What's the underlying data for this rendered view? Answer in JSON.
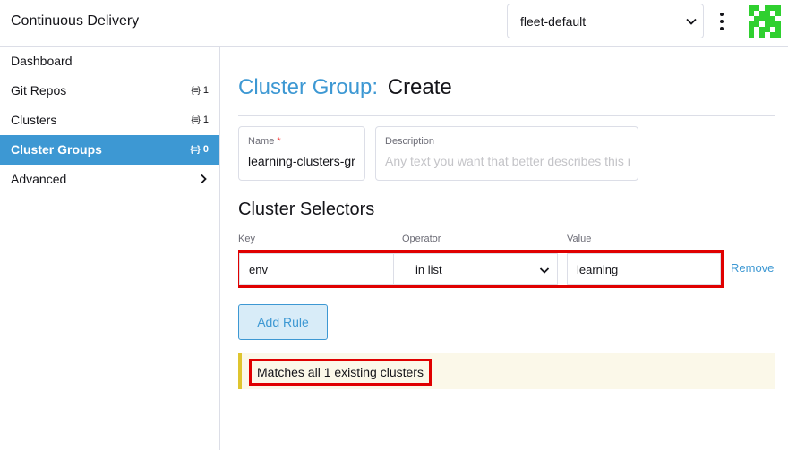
{
  "header": {
    "app_title": "Continuous Delivery",
    "workspace_select": {
      "selected": "fleet-default"
    },
    "more_menu_icon": "kebab-vertical-icon",
    "logo_icon": "rancher-checker-logo"
  },
  "sidebar": {
    "items": [
      {
        "label": "Dashboard",
        "count": "",
        "active": false
      },
      {
        "label": "Git Repos",
        "count": "1",
        "active": false
      },
      {
        "label": "Clusters",
        "count": "1",
        "active": false
      },
      {
        "label": "Cluster Groups",
        "count": "0",
        "active": true
      },
      {
        "label": "Advanced",
        "count": "",
        "active": false,
        "expandable": true
      }
    ],
    "count_icon": "braces-icon"
  },
  "main": {
    "title_resource": "Cluster Group:",
    "title_mode": "Create",
    "name_field": {
      "label": "Name",
      "required_mark": "*",
      "value": "learning-clusters-gr"
    },
    "description_field": {
      "label": "Description",
      "placeholder": "Any text you want that better describes this r"
    },
    "selectors": {
      "section_title": "Cluster Selectors",
      "columns": {
        "key": "Key",
        "operator": "Operator",
        "value": "Value"
      },
      "rules": [
        {
          "key": "env",
          "operator": "in list",
          "value": "learning",
          "remove_label": "Remove"
        }
      ],
      "add_rule_label": "Add Rule"
    },
    "match_banner": "Matches all 1 existing clusters"
  },
  "colors": {
    "accent": "#3d98d3",
    "highlight_box": "#e00000",
    "banner_bg": "#fbf8e9",
    "banner_border": "#dfc52f",
    "logo_green": "#2fd02f"
  }
}
